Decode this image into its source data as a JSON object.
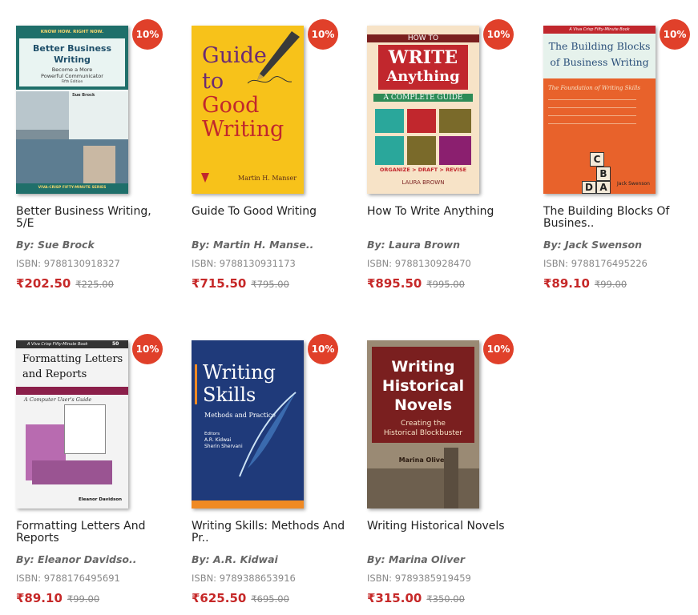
{
  "books": [
    {
      "title": "Better Business Writing, 5/E",
      "author": "By: Sue Brock",
      "isbn": "ISBN: 9788130918327",
      "price": "₹202.50",
      "mrp": "₹225.00",
      "discount": "10%",
      "cover": {
        "line1": "Better Business",
        "line2": "Writing",
        "line3": "Become a More",
        "line4": "Powerful Communicator",
        "top": "KNOW HOW. RIGHT NOW.",
        "author": "Sue Brock",
        "edition": "Fifth Edition",
        "series": "VIVA-CRISP FIFTY-MINUTE SERIES"
      }
    },
    {
      "title": "Guide To Good Writing",
      "author": "By: Martin H. Manse..",
      "isbn": "ISBN: 9788130931173",
      "price": "₹715.50",
      "mrp": "₹795.00",
      "discount": "10%",
      "cover": {
        "line1": "Guide",
        "line2": "to",
        "line3": "Good",
        "line4": "Writing",
        "author": "Martin H. Manser"
      }
    },
    {
      "title": "How To Write Anything",
      "author": "By: Laura Brown",
      "isbn": "ISBN: 9788130928470",
      "price": "₹895.50",
      "mrp": "₹995.00",
      "discount": "10%",
      "cover": {
        "line1": "HOW TO",
        "line2": "WRITE",
        "line3": "Anything",
        "line4": "A COMPLETE GUIDE",
        "tagline": "ORGANIZE > DRAFT > REVISE",
        "author": "LAURA BROWN"
      }
    },
    {
      "title": "The Building Blocks Of Busines..",
      "author": "By: Jack Swenson",
      "isbn": "ISBN: 9788176495226",
      "price": "₹89.10",
      "mrp": "₹99.00",
      "discount": "10%",
      "cover": {
        "top": "A Viva Crisp Fifty-Minute Book",
        "line1": "The Building Blocks",
        "line2": "of Business Writing",
        "line3": "The Foundation of Writing Skills",
        "blocks": [
          "C",
          "B",
          "D",
          "A"
        ],
        "author": "Jack Swenson"
      }
    },
    {
      "title": "Formatting Letters And Reports",
      "author": "By: Eleanor Davidso..",
      "isbn": "ISBN: 9788176495691",
      "price": "₹89.10",
      "mrp": "₹99.00",
      "discount": "10%",
      "cover": {
        "top": "A Viva Crisp Fifty-Minute Book",
        "number": "50",
        "line1": "Formatting Letters",
        "line2": "and Reports",
        "line3": "A Computer User's Guide",
        "author": "Eleanor Davidson"
      }
    },
    {
      "title": "Writing Skills: Methods And Pr..",
      "author": "By: A.R. Kidwai",
      "isbn": "ISBN: 9789388653916",
      "price": "₹625.50",
      "mrp": "₹695.00",
      "discount": "10%",
      "cover": {
        "line1": "Writing",
        "line2": "Skills",
        "line3": "Methods and Practice",
        "editors_label": "Editors",
        "editor1": "A.R. Kidwai",
        "editor2": "Sherin Shervani"
      }
    },
    {
      "title": "Writing Historical Novels",
      "author": "By: Marina Oliver",
      "isbn": "ISBN: 9789385919459",
      "price": "₹315.00",
      "mrp": "₹350.00",
      "discount": "10%",
      "cover": {
        "line1": "Writing",
        "line2": "Historical",
        "line3": "Novels",
        "line4": "Creating the",
        "line5": "Historical Blockbuster",
        "author": "Marina Oliver"
      }
    }
  ]
}
